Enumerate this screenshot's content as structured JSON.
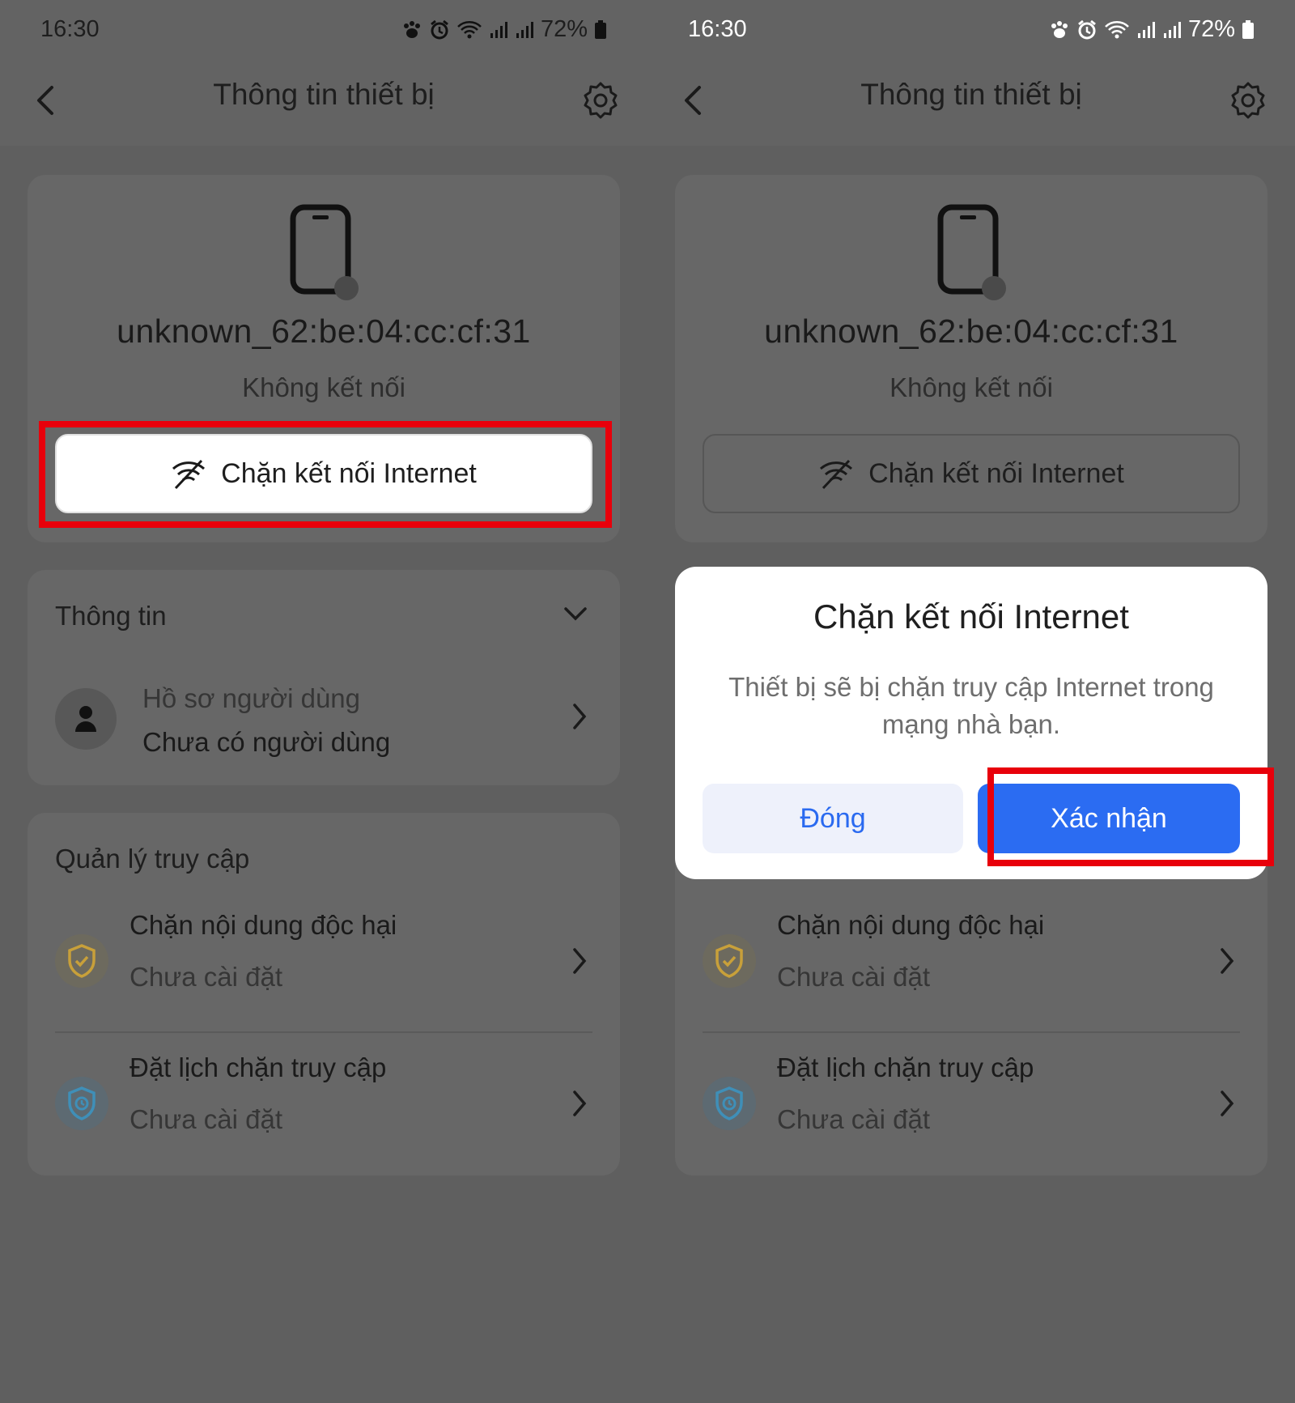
{
  "status_bar": {
    "time": "16:30",
    "battery": "72%"
  },
  "header": {
    "title": "Thông tin thiết bị"
  },
  "device": {
    "name": "unknown_62:be:04:cc:cf:31",
    "status": "Không kết nối",
    "block_button_label": "Chặn kết nối Internet"
  },
  "info_section": {
    "title": "Thông tin",
    "profile_label": "Hồ sơ người dùng",
    "profile_value": "Chưa có người dùng"
  },
  "access_section": {
    "title": "Quản lý truy cập",
    "items": [
      {
        "title": "Chặn nội dung độc hại",
        "status": "Chưa cài đặt"
      },
      {
        "title": "Đặt lịch chặn truy cập",
        "status": "Chưa cài đặt"
      }
    ]
  },
  "dialog": {
    "title": "Chặn kết nối Internet",
    "message": "Thiết bị sẽ bị chặn truy cập Internet trong mạng nhà bạn.",
    "close_label": "Đóng",
    "confirm_label": "Xác nhận"
  },
  "colors": {
    "highlight": "#e8000b",
    "primary": "#2b6cf2",
    "shield_yellow": "#c8a03a",
    "shield_blue": "#3f8fb8"
  },
  "icons": [
    "paw-icon",
    "alarm-icon",
    "wifi-icon",
    "signal-icon",
    "battery-icon",
    "back-arrow-icon",
    "gear-icon",
    "phone-icon",
    "no-wifi-icon",
    "chevron-down-icon",
    "person-icon",
    "chevron-right-icon",
    "shield-check-icon",
    "shield-clock-icon"
  ]
}
